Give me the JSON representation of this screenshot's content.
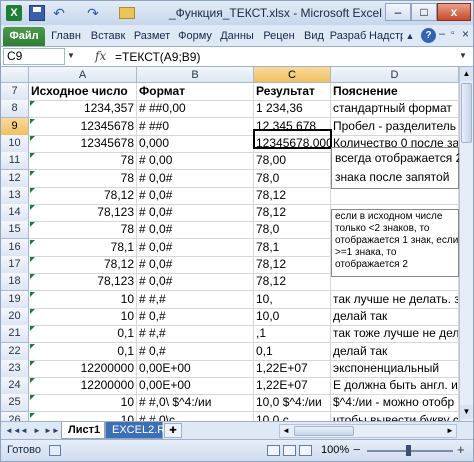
{
  "window": {
    "title": "_Функция_ТЕКСТ.xlsx - Microsoft Excel",
    "logo": "X",
    "min": "–",
    "max": "□",
    "close": "x"
  },
  "ribbon": {
    "tabs": [
      "Файл",
      "Главн",
      "Вставк",
      "Размет",
      "Форму",
      "Данны",
      "Рецен",
      "Вид",
      "Разраб",
      "Надстр"
    ],
    "help": "?"
  },
  "formula_bar": {
    "name_box": "C9",
    "fx": "fx",
    "formula": "=ТЕКСТ(A9;B9)"
  },
  "columns": [
    "A",
    "B",
    "C",
    "D"
  ],
  "rows": [
    {
      "n": "7",
      "a": "Исходное число",
      "b": "Формат",
      "c": "Результат",
      "d": "Пояснение",
      "header": true
    },
    {
      "n": "8",
      "a": "1234,357",
      "b": "# ##0,00",
      "c": "1 234,36",
      "d": "стандартный формат"
    },
    {
      "n": "9",
      "a": "12345678",
      "b": "# ##0",
      "c": "12 345 678",
      "d": "Пробел - разделитель г"
    },
    {
      "n": "10",
      "a": "12345678",
      "b": "0,000",
      "c": "12345678,000",
      "d": "Количество 0 после зап"
    },
    {
      "n": "11",
      "a": "78",
      "b": "# 0,00",
      "c": "78,00",
      "d": ""
    },
    {
      "n": "12",
      "a": "78",
      "b": "# 0,0#",
      "c": "78,0",
      "d": ""
    },
    {
      "n": "13",
      "a": "78,12",
      "b": "# 0,0#",
      "c": "78,12",
      "d": ""
    },
    {
      "n": "14",
      "a": "78,123",
      "b": "# 0,0#",
      "c": "78,12",
      "d": ""
    },
    {
      "n": "15",
      "a": "78",
      "b": "# 0,0#",
      "c": "78,0",
      "d": ""
    },
    {
      "n": "16",
      "a": "78,1",
      "b": "# 0,0#",
      "c": "78,1",
      "d": ""
    },
    {
      "n": "17",
      "a": "78,12",
      "b": "# 0,0#",
      "c": "78,12",
      "d": ""
    },
    {
      "n": "18",
      "a": "78,123",
      "b": "# 0,0#",
      "c": "78,12",
      "d": ""
    },
    {
      "n": "19",
      "a": "10",
      "b": "# #,#",
      "c": "10,",
      "d": "так лучше не делать. зн"
    },
    {
      "n": "20",
      "a": "10",
      "b": "# 0,#",
      "c": "10,0",
      "d": "делай так"
    },
    {
      "n": "21",
      "a": "0,1",
      "b": "# #,#",
      "c": ",1",
      "d": "так тоже лучше не дела"
    },
    {
      "n": "22",
      "a": "0,1",
      "b": "# 0,#",
      "c": "0,1",
      "d": "делай так"
    },
    {
      "n": "23",
      "a": "12200000",
      "b": "0,00E+00",
      "c": "1,22E+07",
      "d": "экспоненциальный"
    },
    {
      "n": "24",
      "a": "12200000",
      "b": "0,00E+00",
      "c": "1,22E+07",
      "d": "Е должна быть англ. и в"
    },
    {
      "n": "25",
      "a": "10",
      "b": "# #,0\\ $^4:/ии",
      "c": "10,0 $^4:/ии",
      "d": "$^4:/ии - можно отобр"
    },
    {
      "n": "26",
      "a": "10",
      "b": "# #,0\\c",
      "c": "10,0 c",
      "d": "чтобы вывести букву с,"
    }
  ],
  "note_big": [
    "всегда отображается 2",
    "знака после запятой"
  ],
  "note_small": [
    "если в исходном числе",
    "только <2 знаков, то",
    "отображается 1 знак, если",
    ">=1 знака, то",
    "отображается 2"
  ],
  "sheets": {
    "tabs": [
      "Лист1",
      "EXCEL2.RU"
    ],
    "nav": [
      "◄◄",
      "◄",
      "►",
      "►►"
    ]
  },
  "status": {
    "ready": "Готово",
    "zoom": "100%",
    "zoom_out": "−",
    "zoom_in": "+"
  },
  "colors": {
    "header_bg": "#dde6f2",
    "selected_header": "#f0c060",
    "file_tab": "#2e7d32",
    "sheet2_tab": "#3c6fb6"
  }
}
